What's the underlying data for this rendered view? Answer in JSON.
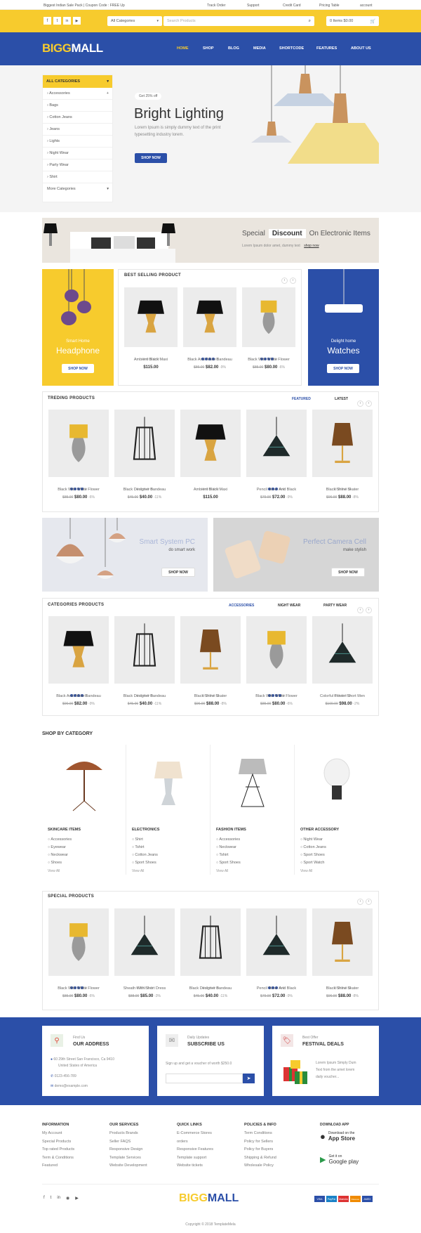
{
  "topbar": {
    "promo": "Biggest Indian Sale Pack | Coupon Code : FREE Up",
    "links": [
      "Track Order",
      "Support",
      "Credit Card",
      "Pricing Table",
      "account"
    ]
  },
  "search": {
    "category": "All Categories",
    "placeholder": "Search Products",
    "cart": "0 Items $0.00"
  },
  "brand": {
    "big": "BIGG",
    "mall": "MALL"
  },
  "nav": [
    "HOME",
    "SHOP",
    "BLOG",
    "MEDIA",
    "SHORTCODE",
    "FEATURES",
    "ABOUT US"
  ],
  "sidebar": {
    "title": "ALL CATEGORIES",
    "items": [
      "Accessories",
      "Bags",
      "Cotton Jeans",
      "Jeans",
      "Lights",
      "Night Wear",
      "Party Wear",
      "Shirt"
    ],
    "more": "More Categories"
  },
  "hero": {
    "badge": "Get 25% off",
    "title": "Bright Lighting",
    "text1": "Lorem Ipsum is simply dummy text of the print",
    "text2": "typesetting industry lorem.",
    "button": "SHOP NOW"
  },
  "discount_banner": {
    "special": "Special",
    "discount": "Discount",
    "on": "On Electronic Items",
    "sub": "Lorem Ipsum dolor amet, dummy text",
    "link": "shop now"
  },
  "best_selling": {
    "title": "BEST SELLING PRODUCT",
    "left": {
      "small": "Smart Home",
      "big": "Headphone",
      "btn": "SHOP NOW"
    },
    "right": {
      "small": "Delight home",
      "big": "Watches",
      "btn": "SHOP NOW"
    },
    "products": [
      {
        "name": "Ambient Black Maxi",
        "price": "$115.00",
        "old": "",
        "off": "",
        "stars": 0
      },
      {
        "name": "Black And White Bandeau",
        "price": "$82.00",
        "old": "$86.00",
        "off": "-9%",
        "stars": 4
      },
      {
        "name": "Black With White Flower",
        "price": "$80.00",
        "old": "$85.00",
        "off": "-6%",
        "stars": 4
      }
    ]
  },
  "trending": {
    "title": "TREDING PRODUCTS",
    "tabs": [
      "FEATURED",
      "LATEST"
    ],
    "products": [
      {
        "name": "Black With White Flower",
        "price": "$80.00",
        "old": "$85.00",
        "off": "-6%",
        "stars": 4
      },
      {
        "name": "Black Designer Bandeau",
        "price": "$40.00",
        "old": "$45.00",
        "off": "-11%",
        "stars": 0
      },
      {
        "name": "Ambient Black Maxi",
        "price": "$115.00",
        "old": "",
        "off": "",
        "stars": 0
      },
      {
        "name": "Pencil Silver And Black",
        "price": "$72.00",
        "old": "$79.00",
        "off": "-9%",
        "stars": 3
      },
      {
        "name": "Black Shine Skater",
        "price": "$88.00",
        "old": "$96.00",
        "off": "-8%",
        "stars": 0
      }
    ]
  },
  "promo_banners": [
    {
      "title": "Smart System PC",
      "sub": "do smart work",
      "btn": "SHOP NOW"
    },
    {
      "title": "Perfect Camera Cell",
      "sub": "make stylish",
      "btn": "SHOP NOW"
    }
  ],
  "categories_products": {
    "title": "CATEGORIES PRODUCTS",
    "tabs": [
      "ACCESSORIES",
      "NIGHT WEAR",
      "PARTY WEAR"
    ],
    "products": [
      {
        "name": "Black And White Bandeau",
        "price": "$82.00",
        "old": "$90.00",
        "off": "-9%",
        "stars": 4
      },
      {
        "name": "Black Designer Bandeau",
        "price": "$40.00",
        "old": "$45.00",
        "off": "-11%",
        "stars": 0
      },
      {
        "name": "Black Shine Skater",
        "price": "$88.00",
        "old": "$96.00",
        "off": "-8%",
        "stars": 0
      },
      {
        "name": "Black With White Flower",
        "price": "$80.00",
        "old": "$85.00",
        "off": "-6%",
        "stars": 4
      },
      {
        "name": "Colorful Flower Short Men",
        "price": "$98.00",
        "old": "$100.00",
        "off": "-2%",
        "stars": 0
      }
    ]
  },
  "shop_by_category": {
    "title": "SHOP BY CATEGORY",
    "cols": [
      {
        "title": "SKINCARE ITEMS",
        "items": [
          "Accessories",
          "Eyewear",
          "Neckwear",
          "Shoes"
        ],
        "more": "View All"
      },
      {
        "title": "ELECTRONICS",
        "items": [
          "Shirt",
          "Tshirt",
          "Cotton Jeans",
          "Sport Shoes"
        ],
        "more": "View All"
      },
      {
        "title": "FASHION ITEMS",
        "items": [
          "Accessories",
          "Neckwear",
          "Tshirt",
          "Sport Shoes"
        ],
        "more": "View All"
      },
      {
        "title": "OTHER ACCESSORY",
        "items": [
          "Night Wear",
          "Cotton Jeans",
          "Sport Shoes",
          "Sport Watch"
        ],
        "more": "View All"
      }
    ]
  },
  "special": {
    "title": "SPECIAL PRODUCTS",
    "products": [
      {
        "name": "Black With White Flower",
        "price": "$80.00",
        "old": "$85.00",
        "off": "-6%",
        "stars": 4
      },
      {
        "name": "Sheath With Short Dress",
        "price": "$85.00",
        "old": "$88.00",
        "off": "-3%",
        "stars": 0
      },
      {
        "name": "Black Designer Bandeau",
        "price": "$40.00",
        "old": "$45.00",
        "off": "-11%",
        "stars": 0
      },
      {
        "name": "Pencil Silver And Black",
        "price": "$72.00",
        "old": "$79.00",
        "off": "-9%",
        "stars": 3
      },
      {
        "name": "Black Shine Skater",
        "price": "$88.00",
        "old": "$96.00",
        "off": "-8%",
        "stars": 0
      }
    ]
  },
  "info": {
    "address": {
      "small": "Find Us",
      "title": "OUR ADDRESS",
      "line1": "60 29th Street San Francisco, Ca 9410",
      "line2": "United States of America",
      "phone": "0123-456-789",
      "email": "demo@example.com"
    },
    "subscribe": {
      "small": "Daily Updates",
      "title": "SUBSCRIBE US",
      "text": "Sign up and get a voucher of worth $250.0"
    },
    "festival": {
      "small": "Best Offer",
      "title": "FESTIVAL DEALS",
      "text1": "Lorem Ipsum Simply Dum",
      "text2": "Text from the amet lorem",
      "text3": "daily voucher..."
    }
  },
  "footer": {
    "cols": [
      {
        "title": "INFORMATION",
        "items": [
          "My Account",
          "Special Products",
          "Top rated Products",
          "Term & Conditions",
          "Featured"
        ]
      },
      {
        "title": "OUR SERVICES",
        "items": [
          "Products Brands",
          "Seller FAQS",
          "Responsive Design",
          "Template Services",
          "Website Development"
        ]
      },
      {
        "title": "QUICK LINKS",
        "items": [
          "E-Commerce Stores",
          "orders",
          "Responsive Features",
          "Template support",
          "Website tickets"
        ]
      },
      {
        "title": "POLICIES & INFO",
        "items": [
          "Term Conditions",
          "Policy for Sellers",
          "Policy for Buyers",
          "Shipping & Refund",
          "Wholesale Policy"
        ]
      }
    ],
    "app": {
      "title": "DOWNLOAD APP",
      "apple_small": "Download on the",
      "apple_big": "App Store",
      "google_small": "Get it on",
      "google_big": "Google play"
    },
    "payments": [
      "VISA",
      "PayPal",
      "Maestro",
      "Discover",
      "AMEX"
    ],
    "copyright": "Copyright © 2018 TemplateMela"
  }
}
